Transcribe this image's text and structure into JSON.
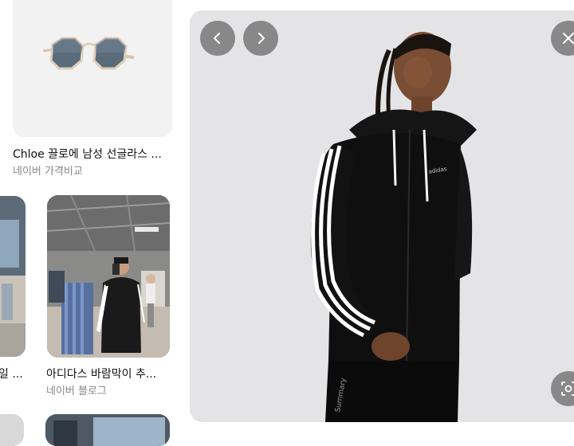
{
  "results": [
    {
      "caption": "Chloe 끌로에 남성 선글라스 ...",
      "source": "네이버 가격비교",
      "image": "sunglasses"
    },
    {
      "caption": "일 ...",
      "source": "",
      "image": "store-interior",
      "badge_icon": "location-pin-icon"
    },
    {
      "caption": "아디다스 바람막이 추...",
      "source": "네이버 블로그",
      "image": "man-in-adidas-jacket-at-store"
    }
  ],
  "viewer": {
    "image": "model-wearing-black-adidas-windbreaker",
    "prev_icon": "chevron-left-icon",
    "next_icon": "chevron-right-icon",
    "close_icon": "close-icon",
    "lens_icon": "lens-search-icon"
  },
  "colors": {
    "panel_bg": "#e4e4e6",
    "control_bg": "#6e6e6e",
    "caption": "#111111",
    "source": "#888888"
  }
}
